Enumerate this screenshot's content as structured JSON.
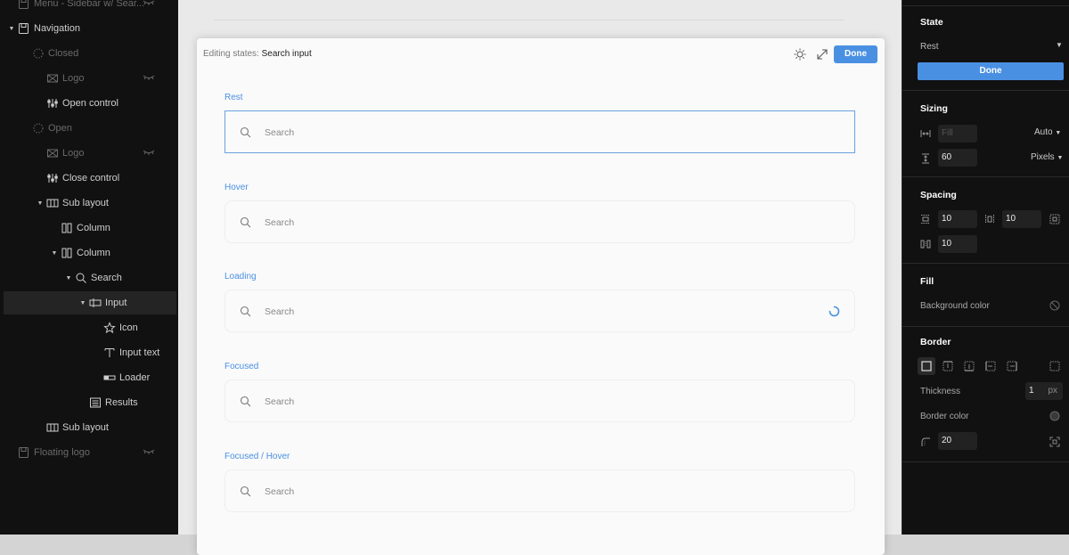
{
  "layers": [
    {
      "label": "Menu - Sidebar w/ Sear...",
      "dim": true,
      "icon": "component-icon",
      "eye": true
    },
    {
      "label": "Navigation",
      "dim": false,
      "icon": "component-icon",
      "caret": true
    },
    {
      "label": "Closed",
      "dim": true,
      "icon": "state-icon"
    },
    {
      "label": "Logo",
      "dim": true,
      "icon": "image-icon",
      "eye": true
    },
    {
      "label": "Open control",
      "dim": false,
      "icon": "control-icon"
    },
    {
      "label": "Open",
      "dim": true,
      "icon": "state-icon"
    },
    {
      "label": "Logo",
      "dim": true,
      "icon": "image-icon",
      "eye": true
    },
    {
      "label": "Close control",
      "dim": false,
      "icon": "control-icon"
    },
    {
      "label": "Sub layout",
      "dim": false,
      "icon": "layout-icon",
      "caret": true
    },
    {
      "label": "Column",
      "dim": false,
      "icon": "column-icon"
    },
    {
      "label": "Column",
      "dim": false,
      "icon": "column-icon",
      "caret": true
    },
    {
      "label": "Search",
      "dim": false,
      "icon": "search-icon",
      "caret": true
    },
    {
      "label": "Input",
      "dim": false,
      "icon": "input-icon",
      "caret": true,
      "selected": true
    },
    {
      "label": "Icon",
      "dim": false,
      "icon": "star-icon"
    },
    {
      "label": "Input text",
      "dim": false,
      "icon": "text-icon"
    },
    {
      "label": "Loader",
      "dim": false,
      "icon": "loader-icon"
    },
    {
      "label": "Results",
      "dim": false,
      "icon": "results-icon"
    },
    {
      "label": "Sub layout",
      "dim": false,
      "icon": "layout-icon"
    },
    {
      "label": "Floating logo",
      "dim": true,
      "icon": "component-icon",
      "eye": true
    }
  ],
  "modal": {
    "title_prefix": "Editing states:",
    "title": "Search input",
    "done_label": "Done",
    "states": [
      {
        "label": "Rest",
        "placeholder": "Search"
      },
      {
        "label": "Hover",
        "placeholder": "Search"
      },
      {
        "label": "Loading",
        "placeholder": "Search",
        "loader": true
      },
      {
        "label": "Focused",
        "placeholder": "Search"
      },
      {
        "label": "Focused / Hover",
        "placeholder": "Search"
      }
    ]
  },
  "inspector": {
    "state": {
      "title": "State",
      "value": "Rest",
      "done_label": "Done"
    },
    "sizing": {
      "title": "Sizing",
      "width_placeholder": "Fill",
      "width_mode": "Auto",
      "height_value": "60",
      "height_mode": "Pixels"
    },
    "spacing": {
      "title": "Spacing",
      "padding_v": "10",
      "padding_h": "10",
      "gap": "10"
    },
    "fill": {
      "title": "Fill",
      "background_label": "Background color"
    },
    "border": {
      "title": "Border",
      "thickness_label": "Thickness",
      "thickness_value": "1",
      "thickness_unit": "px",
      "color_label": "Border color",
      "radius_value": "20"
    }
  },
  "colors": {
    "accent": "#4a90e2",
    "panel": "#111111",
    "canvas": "#e9e9e9"
  }
}
